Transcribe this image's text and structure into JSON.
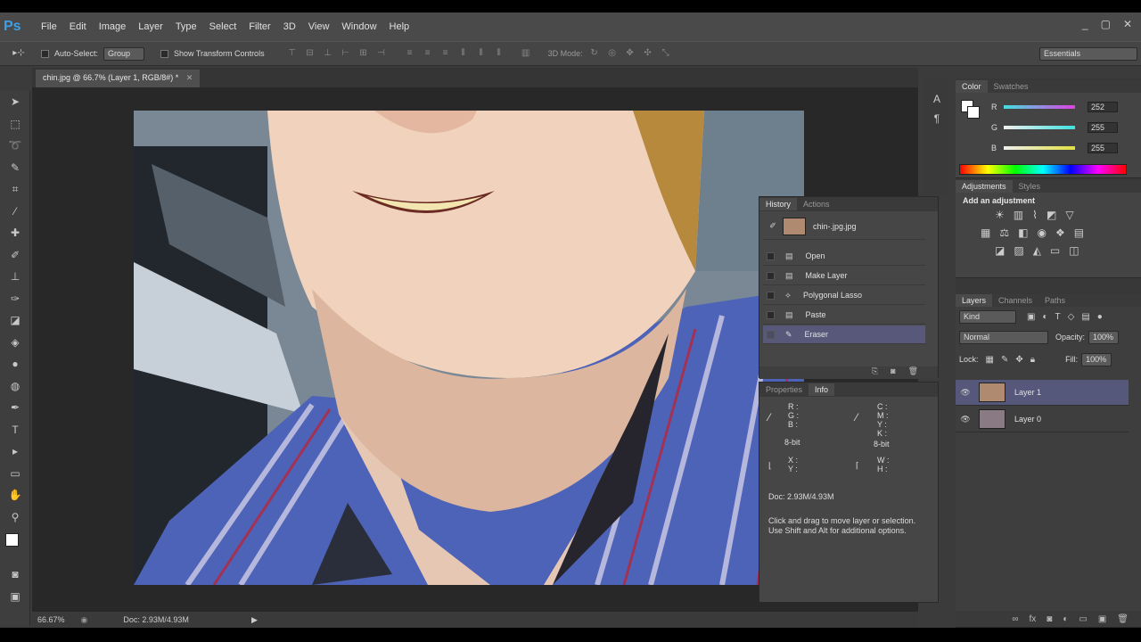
{
  "app": {
    "logo": "Ps"
  },
  "menu": [
    "File",
    "Edit",
    "Image",
    "Layer",
    "Type",
    "Select",
    "Filter",
    "3D",
    "View",
    "Window",
    "Help"
  ],
  "window_buttons": {
    "minimize": "_",
    "restore": "▢",
    "close": "✕"
  },
  "options": {
    "auto_select": "Auto-Select:",
    "group_value": "Group",
    "show_transform": "Show Transform Controls",
    "mode_3d": "3D Mode:",
    "workspace": "Essentials"
  },
  "document": {
    "tab_title": "chin.jpg @ 66.7% (Layer 1, RGB/8#) *",
    "zoom": "66.67%",
    "doc_size": "Doc: 2.93M/4.93M"
  },
  "color_panel": {
    "tabs": [
      "Color",
      "Swatches"
    ],
    "channels": [
      {
        "label": "R",
        "value": "252",
        "color": "#e040e0"
      },
      {
        "label": "G",
        "value": "255",
        "color": "#40e0e0"
      },
      {
        "label": "B",
        "value": "255",
        "color": "#e0e040"
      }
    ]
  },
  "adjustments_panel": {
    "tabs": [
      "Adjustments",
      "Styles"
    ],
    "title": "Add an adjustment"
  },
  "layers_panel": {
    "tabs": [
      "Layers",
      "Channels",
      "Paths"
    ],
    "filter_kind": "Kind",
    "blend_mode": "Normal",
    "opacity_label": "Opacity:",
    "opacity": "100%",
    "lock_label": "Lock:",
    "fill_label": "Fill:",
    "fill": "100%",
    "layers": [
      {
        "name": "Layer 1",
        "selected": true
      },
      {
        "name": "Layer 0",
        "selected": false
      }
    ]
  },
  "history_panel": {
    "tabs": [
      "History",
      "Actions"
    ],
    "snapshot": "chin-.jpg.jpg",
    "items": [
      {
        "label": "Open",
        "selected": false
      },
      {
        "label": "Make Layer",
        "selected": false
      },
      {
        "label": "Polygonal Lasso",
        "selected": false
      },
      {
        "label": "Paste",
        "selected": false
      },
      {
        "label": "Eraser",
        "selected": true
      }
    ]
  },
  "info_panel": {
    "tabs": [
      "Properties",
      "Info"
    ],
    "rgb": [
      "R :",
      "G :",
      "B :"
    ],
    "cmyk": [
      "C :",
      "M :",
      "Y :",
      "K :"
    ],
    "bit_left": "8-bit",
    "bit_right": "8-bit",
    "xy": [
      "X :",
      "Y :"
    ],
    "wh": [
      "W :",
      "H :"
    ],
    "doc": "Doc: 2.93M/4.93M",
    "hint_line1": "Click and drag to move layer or selection.",
    "hint_line2": "Use Shift and Alt for additional options."
  }
}
